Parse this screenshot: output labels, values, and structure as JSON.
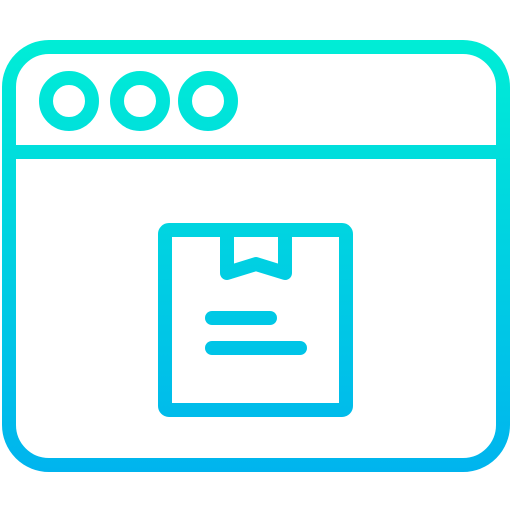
{
  "icon": {
    "name": "web-package-icon",
    "gradient_top": "#00EDD6",
    "gradient_bottom": "#00B4EE"
  },
  "window": {
    "titlebar_dots": [
      "dot-1",
      "dot-2",
      "dot-3"
    ]
  },
  "content": {
    "item": "package-box-icon",
    "text_lines": 2
  }
}
